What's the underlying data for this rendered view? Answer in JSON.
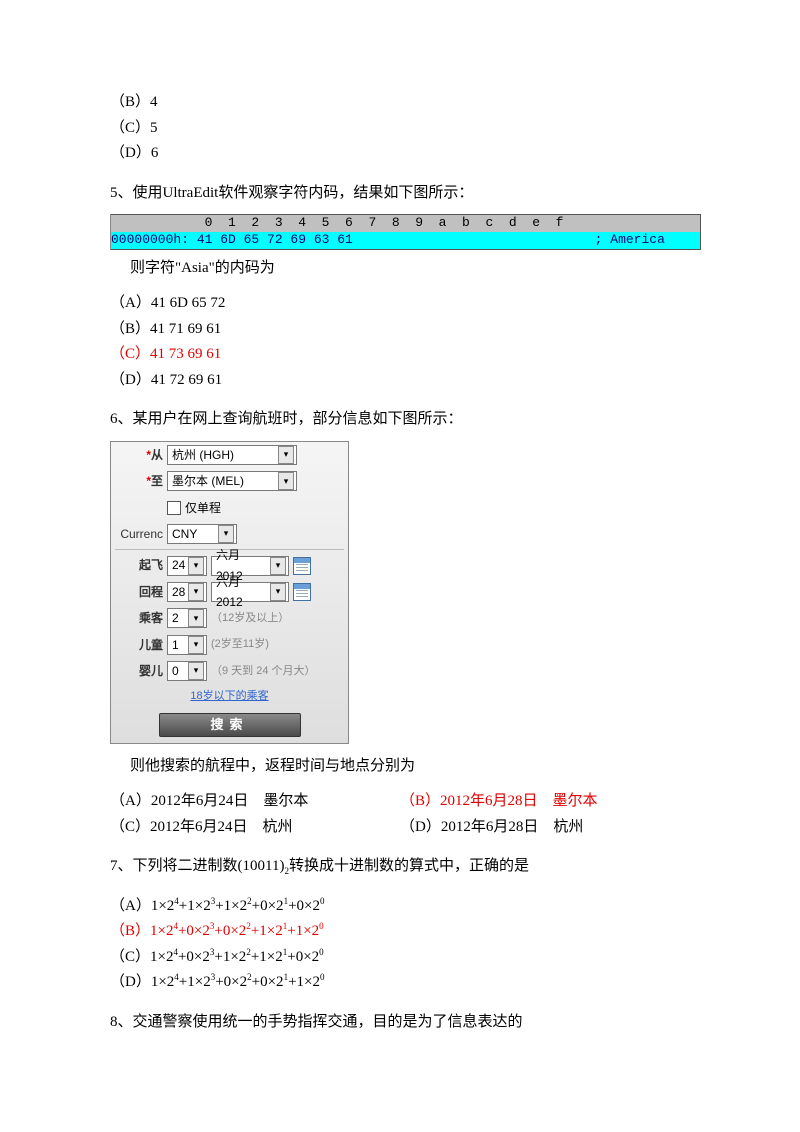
{
  "q4": {
    "optB": "（B）4",
    "optC": "（C）5",
    "optD": "（D）6"
  },
  "q5": {
    "stem": "5、使用UltraEdit软件观察字符内码，结果如下图所示：",
    "hex_header": "            0  1  2  3  4  5  6  7  8  9  a  b  c  d  e  f           ",
    "hex_row": "00000000h: 41 6D 65 72 69 63 61                               ; America",
    "post": "则字符\"Asia\"的内码为",
    "optA": "（A）41 6D 65 72",
    "optB": "（B）41 71 69 61",
    "optC": "（C）41 73 69 61",
    "optD": "（D）41 72 69 61"
  },
  "q6": {
    "stem": "6、某用户在网上查询航班时，部分信息如下图所示：",
    "form": {
      "from_label": "从",
      "from_value": "杭州 (HGH)",
      "to_label": "至",
      "to_value": "墨尔本 (MEL)",
      "oneway": "仅单程",
      "currency_label": "Currenc",
      "currency_value": "CNY",
      "depart_label": "起飞",
      "depart_day": "24",
      "depart_month": "六月 2012",
      "return_label": "回程",
      "return_day": "28",
      "return_month": "六月 2012",
      "pax_label": "乘客",
      "pax_value": "2",
      "pax_hint": "（12岁及以上）",
      "child_label": "儿童",
      "child_value": "1",
      "child_hint": "(2岁至11岁)",
      "infant_label": "婴儿",
      "infant_value": "0",
      "infant_hint": "（9 天到 24 个月大）",
      "under18": "18岁以下的乘客",
      "search": "搜索"
    },
    "post": "则他搜索的航程中，返程时间与地点分别为",
    "optA": "（A）2012年6月24日　墨尔本",
    "optB": "（B）2012年6月28日　墨尔本",
    "optC": "（C）2012年6月24日　杭州",
    "optD": "（D）2012年6月28日　杭州"
  },
  "q7": {
    "stem_a": "7、下列将二进制数(10011)",
    "stem_b": "转换成十进制数的算式中，正确的是",
    "optA_parts": [
      "（A）1×2",
      "+1×2",
      "+1×2",
      "+0×2",
      "+0×2"
    ],
    "optB_parts": [
      "（B）1×2",
      "+0×2",
      "+0×2",
      "+1×2",
      "+1×2"
    ],
    "optC_parts": [
      "（C）1×2",
      "+0×2",
      "+1×2",
      "+1×2",
      "+0×2"
    ],
    "optD_parts": [
      "（D）1×2",
      "+1×2",
      "+0×2",
      "+0×2",
      "+1×2"
    ],
    "exps": [
      "4",
      "3",
      "2",
      "1",
      "0"
    ],
    "sub2": "2"
  },
  "q8": {
    "stem": "8、交通警察使用统一的手势指挥交通，目的是为了信息表达的"
  }
}
